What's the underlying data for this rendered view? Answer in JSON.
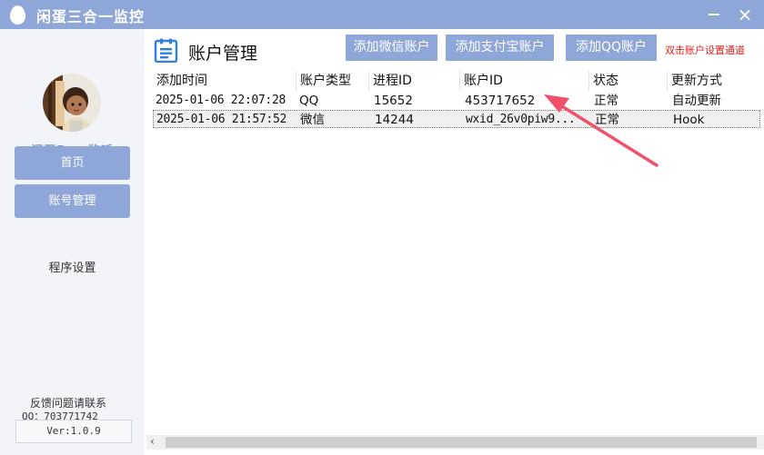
{
  "window": {
    "title": "闲蛋三合一监控",
    "minimize_icon": "minimize-icon",
    "close_label": "×"
  },
  "sidebar": {
    "brand": "闲蛋Pay 监听",
    "nav": [
      {
        "label": "首页"
      },
      {
        "label": "账号管理"
      },
      {
        "label": "程序设置"
      }
    ],
    "feedback_line1": "反馈问题请联系",
    "feedback_line2": "QQ：703771742",
    "version": "Ver:1.0.9"
  },
  "main": {
    "title": "账户管理",
    "buttons": {
      "add_wechat": "添加微信账户",
      "add_alipay": "添加支付宝账户",
      "add_qq": "添加QQ账户"
    },
    "hint": "双击账户设置通道",
    "columns": [
      "添加时间",
      "账户类型",
      "进程ID",
      "账户ID",
      "状态",
      "更新方式"
    ],
    "rows": [
      [
        "2025-01-06 22:07:28",
        "QQ",
        "15652",
        "453717652",
        "正常",
        "自动更新"
      ],
      [
        "2025-01-06 21:57:52",
        "微信",
        "14244",
        "wxid_26v0piw9...",
        "正常",
        "Hook"
      ]
    ]
  },
  "colors": {
    "accent": "#8ea7d8",
    "sidebar_bg": "#f2f4f7",
    "hint": "#e0201c",
    "arrow": "#f0506a"
  }
}
